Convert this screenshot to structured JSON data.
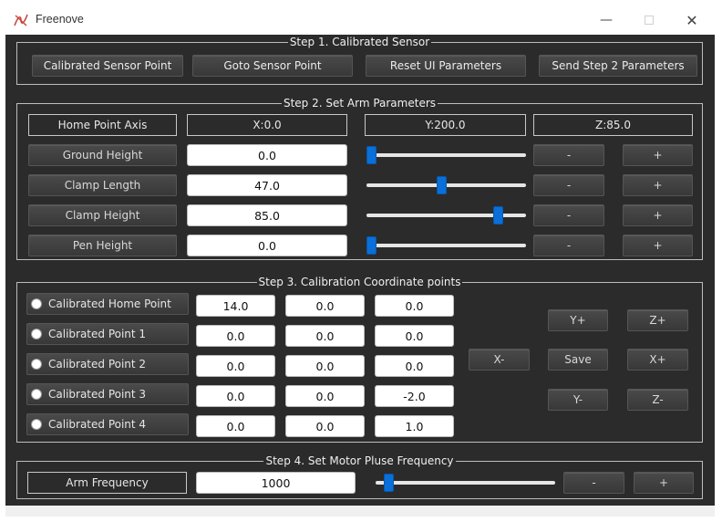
{
  "window": {
    "title": "Freenove",
    "minimize": "—",
    "close": "✕"
  },
  "step1": {
    "title": "Step 1. Calibrated Sensor",
    "buttons": [
      "Calibrated Sensor Point",
      "Goto Sensor Point",
      "Reset UI Parameters",
      "Send Step 2 Parameters"
    ]
  },
  "step2": {
    "title": "Step 2. Set Arm Parameters",
    "home_axis_label": "Home Point Axis",
    "home_x": "X:0.0",
    "home_y": "Y:200.0",
    "home_z": "Z:85.0",
    "rows": [
      {
        "label": "Ground Height",
        "value": "0.0",
        "slider": 0.0
      },
      {
        "label": "Clamp Length",
        "value": "47.0",
        "slider": 0.47
      },
      {
        "label": "Clamp Height",
        "value": "85.0",
        "slider": 0.85
      },
      {
        "label": "Pen Height",
        "value": "0.0",
        "slider": 0.0
      }
    ],
    "minus": "-",
    "plus": "+"
  },
  "step3": {
    "title": "Step 3. Calibration Coordinate points",
    "points": [
      {
        "label": "Calibrated Home Point",
        "x": "14.0",
        "y": "0.0",
        "z": "0.0"
      },
      {
        "label": "Calibrated Point 1",
        "x": "0.0",
        "y": "0.0",
        "z": "0.0"
      },
      {
        "label": "Calibrated Point 2",
        "x": "0.0",
        "y": "0.0",
        "z": "0.0"
      },
      {
        "label": "Calibrated Point 3",
        "x": "0.0",
        "y": "0.0",
        "z": "-2.0"
      },
      {
        "label": "Calibrated Point 4",
        "x": "0.0",
        "y": "0.0",
        "z": "1.0"
      }
    ],
    "controls": {
      "y_plus": "Y+",
      "z_plus": "Z+",
      "x_minus": "X-",
      "save": "Save",
      "x_plus": "X+",
      "y_minus": "Y-",
      "z_minus": "Z-"
    }
  },
  "step4": {
    "title": "Step 4. Set Motor Pluse Frequency",
    "label": "Arm Frequency",
    "value": "1000",
    "slider": 0.05,
    "minus": "-",
    "plus": "+"
  },
  "colors": {
    "background": "#2b2b2b",
    "slider_thumb": "#0a6fd8"
  }
}
